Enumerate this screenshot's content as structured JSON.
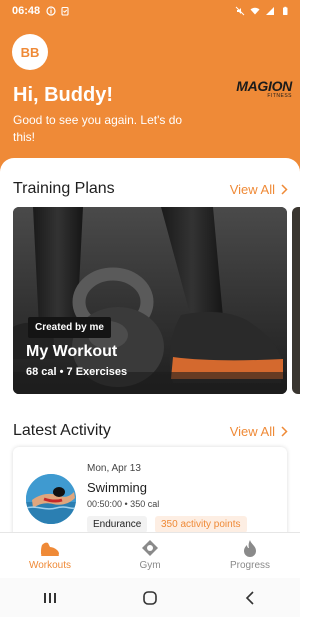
{
  "status_bar": {
    "time": "06:48"
  },
  "header": {
    "avatar_initials": "BB",
    "greeting": "Hi, Buddy!",
    "subtext": "Good to see you again. Let's do this!",
    "logo_brand": "MAGION",
    "logo_sub": "FITNESS"
  },
  "training_plans": {
    "title": "Training Plans",
    "view_all": "View All",
    "card": {
      "badge": "Created by me",
      "name": "My Workout",
      "meta": "68 cal • 7 Exercises"
    }
  },
  "latest_activity": {
    "title": "Latest Activity",
    "view_all": "View All",
    "item": {
      "date": "Mon, Apr 13",
      "name": "Swimming",
      "meta": "00:50:00 • 350 cal",
      "tag_type": "Endurance",
      "tag_points": "350 activity points"
    }
  },
  "bottom_nav": {
    "items": [
      {
        "label": "Workouts",
        "icon": "shoe-icon",
        "active": true
      },
      {
        "label": "Gym",
        "icon": "location-icon",
        "active": false
      },
      {
        "label": "Progress",
        "icon": "flame-icon",
        "active": false
      }
    ]
  },
  "colors": {
    "accent": "#ef8a37",
    "text": "#1f1f1f",
    "muted": "#8a8a8a"
  }
}
